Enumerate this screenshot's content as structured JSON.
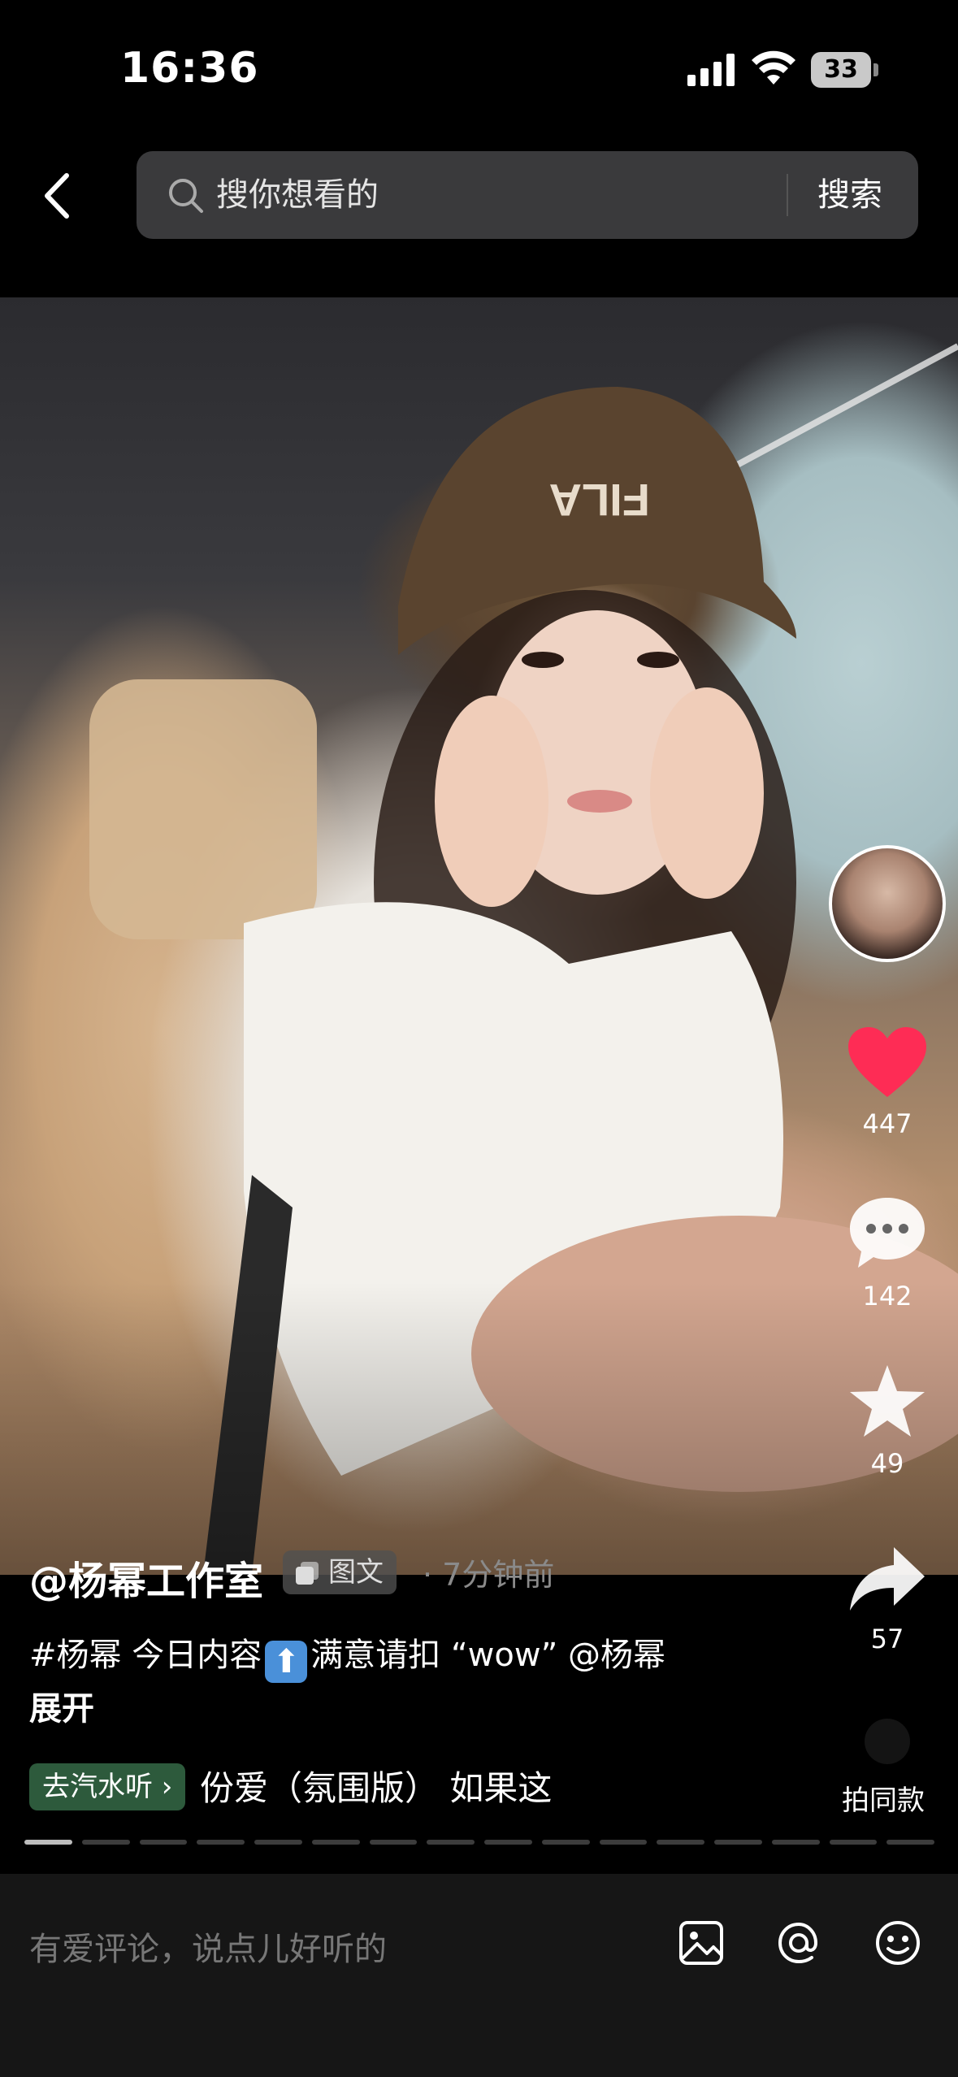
{
  "status_bar": {
    "time": "16:36",
    "battery": "33"
  },
  "header": {
    "search_placeholder": "搜你想看的",
    "search_button": "搜索"
  },
  "actions": {
    "like_count": "447",
    "comment_count": "142",
    "favorite_count": "49",
    "share_count": "57",
    "same_style_label": "拍同款"
  },
  "post": {
    "author": "@杨幂工作室",
    "type_label": "图文",
    "timestamp": "· 7分钟前",
    "caption_before": "#杨幂 今日内容",
    "caption_arrow": "⬆",
    "caption_after": "满意请扣 “wow” @杨幂",
    "expand": "展开"
  },
  "music": {
    "chip_label": "去汽水听 ›",
    "title": "份爱（氛围版）   如果这"
  },
  "progress": {
    "total_segments": 16,
    "current_segment": 1
  },
  "comment_bar": {
    "placeholder": "有爱评论，说点儿好听的"
  },
  "colors": {
    "like": "#fe2c55",
    "background": "#000000",
    "bar": "#161616"
  },
  "icons": [
    "back-arrow-icon",
    "search-icon",
    "heart-icon",
    "comment-icon",
    "star-icon",
    "share-icon",
    "image-icon",
    "at-icon",
    "emoji-icon"
  ]
}
